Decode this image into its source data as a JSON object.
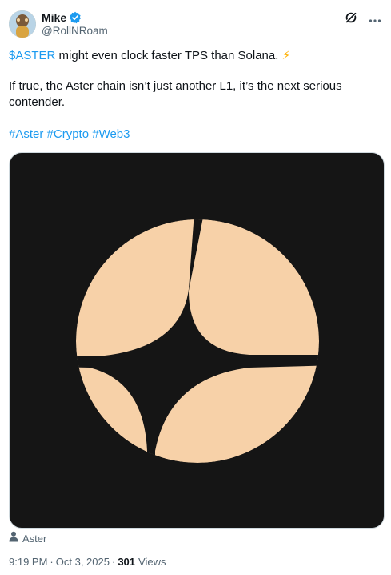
{
  "author": {
    "display_name": "Mike",
    "handle": "@RollNRoam",
    "verified": true
  },
  "tweet": {
    "cashtag": "$ASTER",
    "line1_rest": " might even clock faster TPS than Solana. ",
    "line1_emoji": "⚡",
    "line2": "If true, the Aster chain isn’t just another L1, it’s the next serious contender.",
    "hashtags": [
      "#Aster",
      "#Crypto",
      "#Web3"
    ]
  },
  "media": {
    "logo_color": "#f7d1a8",
    "background_color": "#151515",
    "tagged_user": "Aster"
  },
  "meta": {
    "time": "9:19 PM",
    "separator": "·",
    "date": "Oct 3, 2025",
    "views_count": "301",
    "views_label": "Views"
  },
  "colors": {
    "accent": "#1d9bf0",
    "muted_text": "#536471"
  },
  "icons": {
    "verified": "verified-badge-icon",
    "grok": "grok-icon",
    "more": "more-options-icon",
    "tag": "person-tag-icon"
  }
}
